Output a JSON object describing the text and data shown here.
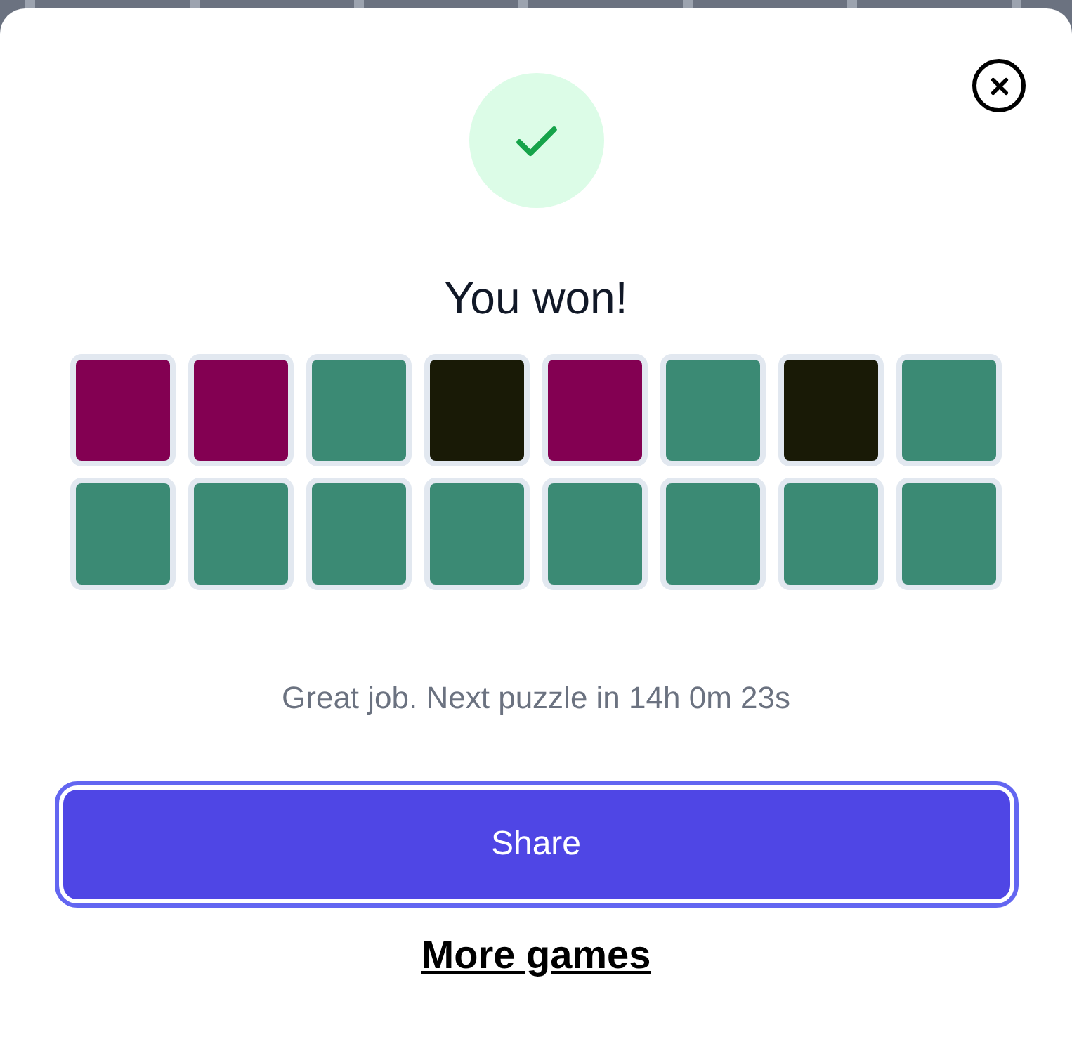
{
  "dialog": {
    "title": "You won!",
    "rows": [
      {
        "tiles": [
          {
            "color": "#830052"
          },
          {
            "color": "#830052"
          },
          {
            "color": "#3b8a74"
          },
          {
            "color": "#191a06"
          },
          {
            "color": "#830052"
          },
          {
            "color": "#3b8a74"
          },
          {
            "color": "#191a06"
          },
          {
            "color": "#3b8a74"
          }
        ]
      },
      {
        "tiles": [
          {
            "color": "#3b8a74"
          },
          {
            "color": "#3b8a74"
          },
          {
            "color": "#3b8a74"
          },
          {
            "color": "#3b8a74"
          },
          {
            "color": "#3b8a74"
          },
          {
            "color": "#3b8a74"
          },
          {
            "color": "#3b8a74"
          },
          {
            "color": "#3b8a74"
          }
        ]
      }
    ],
    "message": "Great job. Next puzzle in 14h 0m 23s",
    "share_button": "Share",
    "more_games_link": "More games"
  }
}
